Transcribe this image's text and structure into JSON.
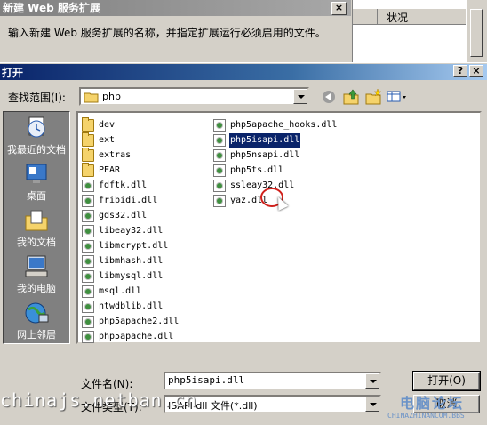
{
  "background_dialog": {
    "title": "新建 Web 服务扩展",
    "instruction": "输入新建 Web 服务扩展的名称，并指定扩展运行必须启用的文件。",
    "status_column": "状况",
    "close_glyph": "×"
  },
  "open_dialog": {
    "title": "打开",
    "help_glyph": "?",
    "close_glyph": "×",
    "lookin_label": "查找范围(I):",
    "lookin_value": "php",
    "places": [
      {
        "label": "我最近的文档",
        "icon": "recent-documents-icon"
      },
      {
        "label": "桌面",
        "icon": "desktop-icon"
      },
      {
        "label": "我的文档",
        "icon": "my-documents-icon"
      },
      {
        "label": "我的电脑",
        "icon": "my-computer-icon"
      },
      {
        "label": "网上邻居",
        "icon": "network-places-icon"
      }
    ],
    "files_col1": [
      {
        "name": "dev",
        "type": "folder"
      },
      {
        "name": "ext",
        "type": "folder"
      },
      {
        "name": "extras",
        "type": "folder"
      },
      {
        "name": "PEAR",
        "type": "folder"
      },
      {
        "name": "fdftk.dll",
        "type": "dll"
      },
      {
        "name": "fribidi.dll",
        "type": "dll"
      },
      {
        "name": "gds32.dll",
        "type": "dll"
      },
      {
        "name": "libeay32.dll",
        "type": "dll"
      },
      {
        "name": "libmcrypt.dll",
        "type": "dll"
      },
      {
        "name": "libmhash.dll",
        "type": "dll"
      },
      {
        "name": "libmysql.dll",
        "type": "dll"
      },
      {
        "name": "msql.dll",
        "type": "dll"
      },
      {
        "name": "ntwdblib.dll",
        "type": "dll"
      },
      {
        "name": "php5apache2.dll",
        "type": "dll"
      },
      {
        "name": "php5apache.dll",
        "type": "dll"
      }
    ],
    "files_col2": [
      {
        "name": "php5apache_hooks.dll",
        "type": "dll"
      },
      {
        "name": "php5isapi.dll",
        "type": "dll",
        "selected": true
      },
      {
        "name": "php5nsapi.dll",
        "type": "dll"
      },
      {
        "name": "php5ts.dll",
        "type": "dll"
      },
      {
        "name": "ssleay32.dll",
        "type": "dll"
      },
      {
        "name": "yaz.dll",
        "type": "dll"
      }
    ],
    "filename_label": "文件名(N):",
    "filename_value": "php5isapi.dll",
    "filetype_label": "文件类型(T):",
    "filetype_value": "ISAPI dll 文件(*.dll)",
    "open_button": "打开(O)",
    "cancel_button": "取消"
  },
  "watermarks": {
    "left": "chinajs.netban.cn",
    "right_cn": "电脑论坛",
    "right_en": "CHINAZHINANCOM.BBS"
  },
  "colors": {
    "titlebar_active": "#0a246a",
    "dialog_face": "#d4d0c8",
    "selection": "#0a246a",
    "places_bar": "#808080"
  }
}
